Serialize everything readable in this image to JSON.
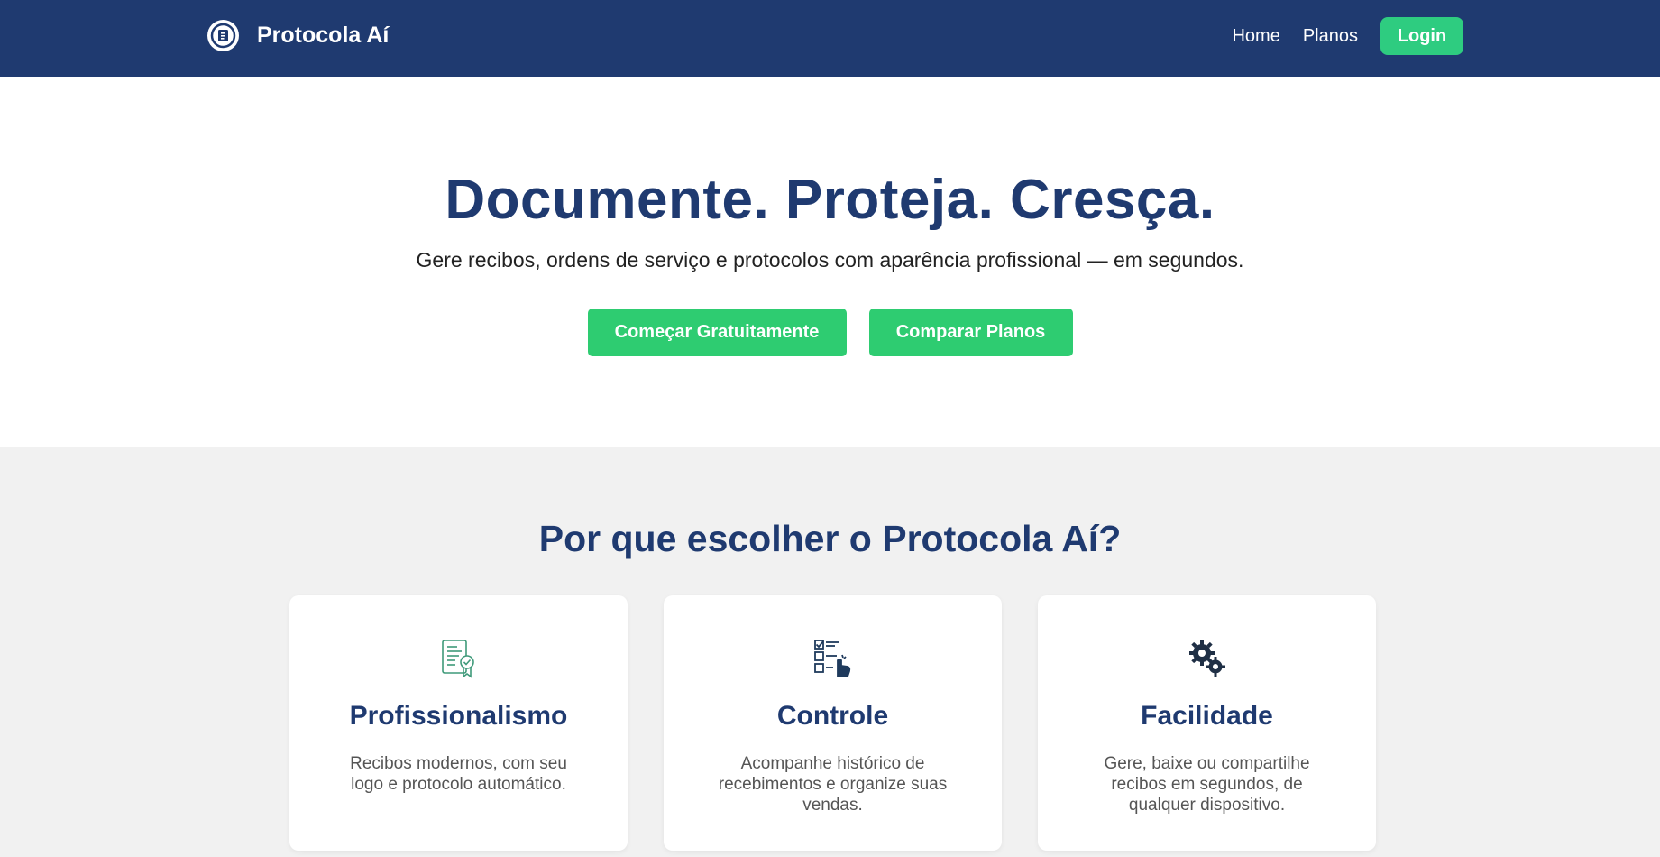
{
  "navbar": {
    "brand": "Protocola Aí",
    "links": [
      "Home",
      "Planos"
    ],
    "login": "Login"
  },
  "hero": {
    "title": "Documente. Proteja. Cresça.",
    "subtitle": "Gere recibos, ordens de serviço e protocolos com aparência profissional — em segundos.",
    "primary_cta": "Começar Gratuitamente",
    "secondary_cta": "Comparar Planos"
  },
  "features": {
    "title": "Por que escolher o Protocola Aí?",
    "cards": [
      {
        "icon": "certificate-icon",
        "title": "Profissionalismo",
        "text": "Recibos modernos, com seu logo e protocolo automático."
      },
      {
        "icon": "checklist-icon",
        "title": "Controle",
        "text": "Acompanhe histórico de recebimentos e organize suas vendas."
      },
      {
        "icon": "gears-icon",
        "title": "Facilidade",
        "text": "Gere, baixe ou compartilhe recibos em segundos, de qualquer dispositivo."
      }
    ]
  },
  "colors": {
    "navy": "#1f3a70",
    "green": "#2ecc71",
    "background": "#f1f1f1"
  }
}
